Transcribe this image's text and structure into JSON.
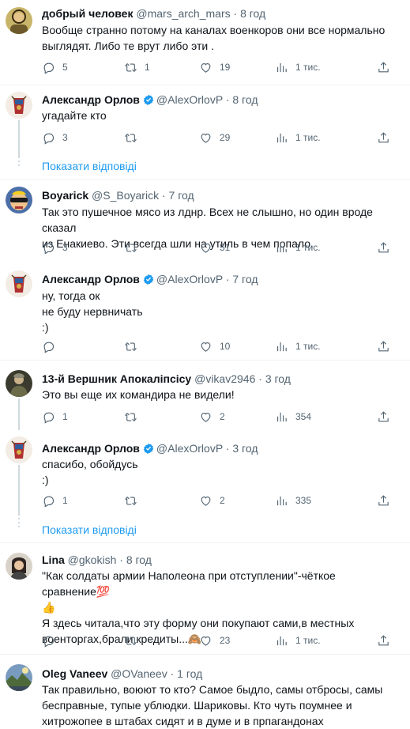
{
  "tweets": [
    {
      "name": "добрый человек",
      "handle": "@mars_arch_mars",
      "time": "8 год",
      "lines": [
        "Вообще странно потому на каналах военкоров они все нормально",
        "выглядят. Либо те врут либо эти ."
      ],
      "replies": "5",
      "retweets": "1",
      "likes": "19",
      "views": "1 тис."
    },
    {
      "name": "Александр Орлов",
      "handle": "@AlexOrlovP",
      "time": "8 год",
      "lines": [
        "угадайте кто"
      ],
      "replies": "3",
      "retweets": "",
      "likes": "29",
      "views": "1 тис."
    },
    {
      "name": "Boyarick",
      "handle": "@S_Boyarick",
      "time": "7 год",
      "lines": [
        "Так это пушечное мясо из лднр. Всех не слышно, но один вроде сказал",
        "из Енакиево. Эти всегда шли на утиль в чем попало."
      ],
      "replies": "3",
      "retweets": "",
      "likes": "51",
      "views": "1 тис."
    },
    {
      "name": "Александр Орлов",
      "handle": "@AlexOrlovP",
      "time": "7 год",
      "lines": [
        "ну, тогда ок",
        "не буду нервничать",
        ":)"
      ],
      "replies": "",
      "retweets": "",
      "likes": "10",
      "views": "1 тис."
    },
    {
      "name": "13-й Вершник Апокаліпсісу",
      "handle": "@vikav2946",
      "time": "3 год",
      "lines": [
        "Это вы еще их командира не видели!"
      ],
      "replies": "1",
      "retweets": "",
      "likes": "2",
      "views": "354"
    },
    {
      "name": "Александр Орлов",
      "handle": "@AlexOrlovP",
      "time": "3 год",
      "lines": [
        "спасибо, обойдусь",
        ":)"
      ],
      "replies": "1",
      "retweets": "",
      "likes": "2",
      "views": "335"
    },
    {
      "name": "Lina",
      "handle": "@gkokish",
      "time": "8 год",
      "lines": [
        "\"Как солдаты армии Наполеона при отступлении\"-чёткое сравнение💯",
        "👍",
        "Я здесь читала,что эту форму они покупают сами,в местных",
        "военторгах,брали кредиты...🙈"
      ],
      "replies": "",
      "retweets": "",
      "likes": "23",
      "views": "1 тис."
    },
    {
      "name": "Oleg Vaneev",
      "handle": "@OVaneev",
      "time": "1 год",
      "lines": [
        "Так правильно, воюют то кто? Самое быдло, самы отбросы, самы",
        "бесправные, тупые ублюдки. Шариковы. Кто чуть поумнее и",
        "хитрожопее в штабах сидят и в думе и в прпагандонах"
      ]
    }
  ],
  "show_replies_label": "Показати відповіді",
  "colors": {
    "accent": "#1d9bf0",
    "muted": "#536471",
    "text": "#0f1419",
    "border": "#eff3f4"
  },
  "icons": [
    "reply-icon",
    "retweet-icon",
    "like-icon",
    "views-icon",
    "share-icon",
    "verified-badge-icon"
  ]
}
